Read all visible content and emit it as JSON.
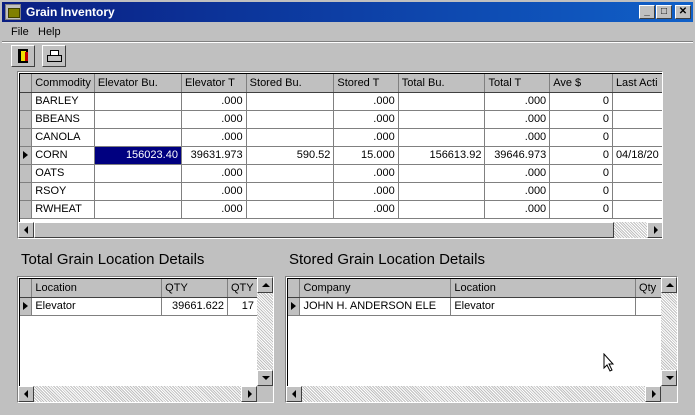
{
  "window": {
    "title": "Grain Inventory",
    "minimize": "_",
    "maximize": "□",
    "close": "✕"
  },
  "menu": {
    "file": "File",
    "help": "Help"
  },
  "toolbar": {
    "exit_icon": "exit-door-icon",
    "print_icon": "printer-icon"
  },
  "main_grid": {
    "columns": [
      "Commodity",
      "Elevator Bu.",
      "Elevator T",
      "Stored Bu.",
      "Stored T",
      "Total Bu.",
      "Total T",
      "Ave $",
      "Last Acti"
    ],
    "rows": [
      [
        "BARLEY",
        "",
        ".000",
        "",
        ".000",
        "",
        ".000",
        "0",
        ""
      ],
      [
        "BBEANS",
        "",
        ".000",
        "",
        ".000",
        "",
        ".000",
        "0",
        ""
      ],
      [
        "CANOLA",
        "",
        ".000",
        "",
        ".000",
        "",
        ".000",
        "0",
        ""
      ],
      [
        "CORN",
        "156023.40",
        "39631.973",
        "590.52",
        "15.000",
        "156613.92",
        "39646.973",
        "0",
        "04/18/20"
      ],
      [
        "OATS",
        "",
        ".000",
        "",
        ".000",
        "",
        ".000",
        "0",
        ""
      ],
      [
        "RSOY",
        "",
        ".000",
        "",
        ".000",
        "",
        ".000",
        "0",
        ""
      ],
      [
        "RWHEAT",
        "",
        ".000",
        "",
        ".000",
        "",
        ".000",
        "0",
        ""
      ]
    ],
    "current_row": 3
  },
  "total_section": {
    "title": "Total Grain Location Details",
    "columns": [
      "Location",
      "QTY",
      "QTY"
    ],
    "rows": [
      [
        "Elevator",
        "39661.622",
        "17"
      ]
    ]
  },
  "stored_section": {
    "title": "Stored Grain Location Details",
    "columns": [
      "Company",
      "Location",
      "Qty"
    ],
    "rows": [
      [
        "JOHN H. ANDERSON ELE",
        "Elevator",
        ""
      ]
    ]
  }
}
